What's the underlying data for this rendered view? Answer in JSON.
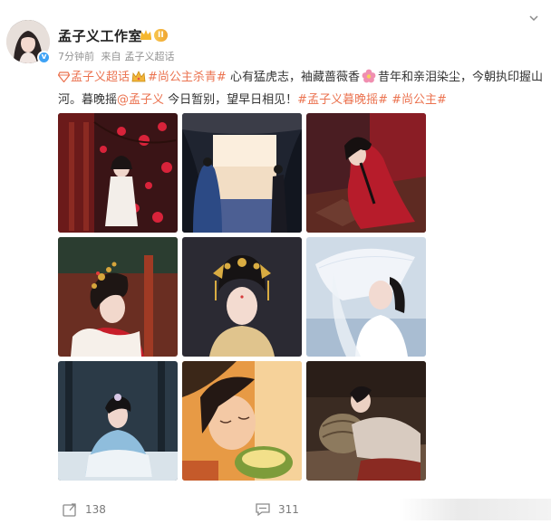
{
  "post": {
    "author": {
      "name": "孟子义工作室",
      "level_badge": "II",
      "avatar_icon": "avatar-photo",
      "verified_icon": "verified-badge-icon"
    },
    "meta": {
      "time": "7分钟前",
      "source_prefix": "来自",
      "source": "孟子义超话"
    },
    "text": {
      "tag_supertopic": "孟子义超话",
      "hashtag_1": "#尚公主杀青#",
      "body_1": " 心有猛虎志，袖藏蔷薇香",
      "body_2": "昔年和亲泪染尘，今朝执印握山河。暮晚摇",
      "mention": "@孟子义",
      "body_3": " 今日暂别，望早日相见！",
      "hashtag_2": "#孟子义暮晚摇#",
      "hashtag_3": "#尚公主#"
    },
    "images": [
      {
        "name": "photo-1",
        "subject": "red plum blossoms and palace"
      },
      {
        "name": "photo-2",
        "subject": "figure before curtained doorway"
      },
      {
        "name": "photo-3",
        "subject": "woman in red kneeling"
      },
      {
        "name": "photo-4",
        "subject": "profile with golden hairpins"
      },
      {
        "name": "photo-5",
        "subject": "portrait with golden headdress"
      },
      {
        "name": "photo-6",
        "subject": "white veiled hat"
      },
      {
        "name": "photo-7",
        "subject": "woman in blue seated outdoors"
      },
      {
        "name": "photo-8",
        "subject": "closeup with closed eyes"
      },
      {
        "name": "photo-9",
        "subject": "woman reclining on cushions"
      }
    ]
  },
  "actions": {
    "repost_count": "138",
    "comment_count": "311"
  },
  "colors": {
    "tag": "#eb7350",
    "meta": "#939393",
    "text": "#333333"
  }
}
